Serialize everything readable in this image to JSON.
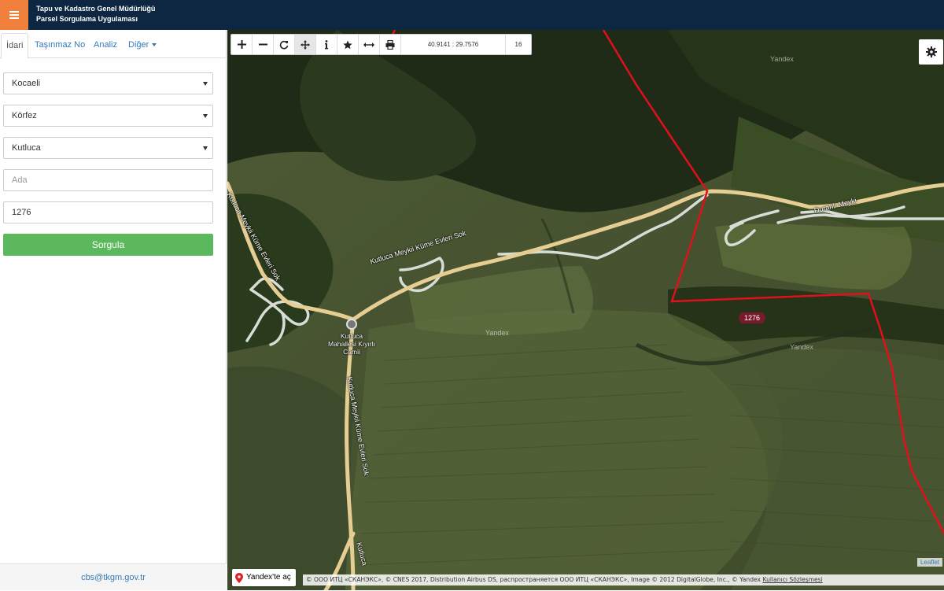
{
  "header": {
    "menu_icon": "hamburger-icon",
    "title_line1": "Tapu ve Kadastro Genel Müdürlüğü",
    "title_line2": "Parsel Sorgulama Uygulaması",
    "colors": {
      "bar": "#0d2641",
      "menu_button": "#f0803c"
    }
  },
  "sidebar": {
    "tabs": [
      {
        "label": "İdari",
        "active": true
      },
      {
        "label": "Taşınmaz No",
        "active": false
      },
      {
        "label": "Analiz",
        "active": false
      },
      {
        "label": "Diğer",
        "active": false,
        "dropdown": true
      }
    ],
    "form": {
      "il": "Kocaeli",
      "ilce": "Körfez",
      "mahalle": "Kutluca",
      "ada_placeholder": "Ada",
      "ada_value": "",
      "parsel_value": "1276",
      "submit_label": "Sorgula",
      "submit_color": "#5cb85c"
    },
    "footer_email": "cbs@tkgm.gov.tr"
  },
  "map": {
    "toolbar": {
      "buttons": [
        "plus-icon",
        "minus-icon",
        "refresh-icon",
        "pan-icon",
        "info-icon",
        "star-icon",
        "measure-icon",
        "print-icon"
      ],
      "coordinates": "40.9141 : 29.7576",
      "zoom_level": "16"
    },
    "settings_icon": "gear-icon",
    "labels": {
      "road_main": "Kutluca Meykii Küme Evleri Sok",
      "road_east": "Duranlı Meyki",
      "road_vertical": "Kutluca Meykii Küme Evleri Sok",
      "road_west": "Kutluca Meykii Küme Evleri Sok",
      "road_south": "Kutluca",
      "poi": "Kutluca Mahallesi Kıyırlı Camii",
      "parcel": "1276",
      "watermark": "Yandex"
    },
    "yandex_button": "Yandex'te aç",
    "attribution_text": "© ООО ИТЦ «СКАНЭКС», © CNES 2017, Distribution Airbus DS, распространяется ООО ИТЦ «СКАНЭКС», Image © 2012 DigitalGlobe, Inc., © Yandex",
    "attribution_link": "Kullanıcı Sözleşmesi",
    "leaflet_label": "Leaflet",
    "parcel_boundary_color": "#e0101c"
  }
}
